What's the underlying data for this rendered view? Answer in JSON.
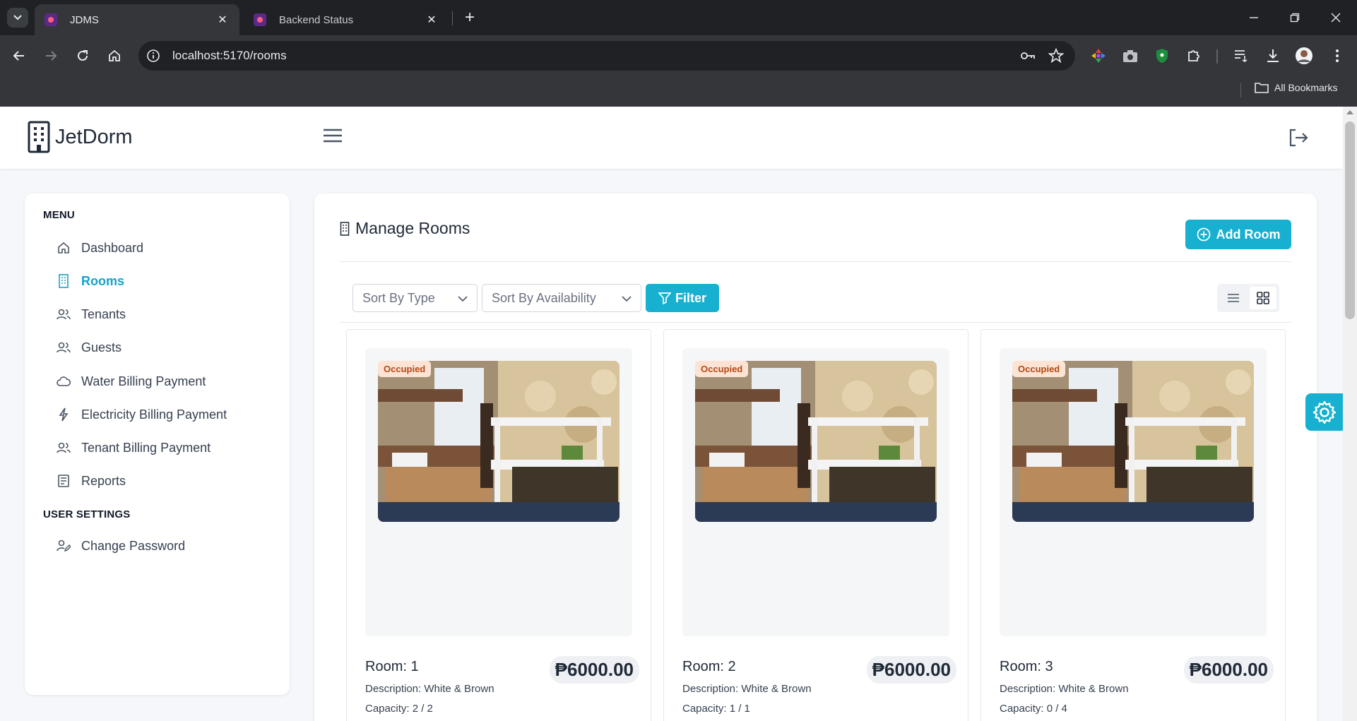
{
  "browser": {
    "tabs": [
      {
        "title": "JDMS",
        "active": true
      },
      {
        "title": "Backend Status",
        "active": false
      }
    ],
    "url": "localhost:5170/rooms",
    "bookmarks_label": "All Bookmarks"
  },
  "app": {
    "brand": "JetDorm",
    "accent_color": "#17b0d0"
  },
  "sidebar": {
    "menu_heading": "MENU",
    "items": [
      {
        "label": "Dashboard",
        "icon": "home-icon",
        "active": false
      },
      {
        "label": "Rooms",
        "icon": "building-icon",
        "active": true
      },
      {
        "label": "Tenants",
        "icon": "users-icon",
        "active": false
      },
      {
        "label": "Guests",
        "icon": "users-icon",
        "active": false
      },
      {
        "label": "Water Billing Payment",
        "icon": "cloud-icon",
        "active": false
      },
      {
        "label": "Electricity Billing Payment",
        "icon": "bolt-icon",
        "active": false
      },
      {
        "label": "Tenant Billing Payment",
        "icon": "users-icon",
        "active": false
      },
      {
        "label": "Reports",
        "icon": "document-icon",
        "active": false
      }
    ],
    "settings_heading": "USER SETTINGS",
    "settings_items": [
      {
        "label": "Change Password",
        "icon": "user-edit-icon"
      }
    ]
  },
  "main": {
    "title": "Manage Rooms",
    "add_button": "Add Room",
    "sort_type": "Sort By Type",
    "sort_availability": "Sort By Availability",
    "filter_button": "Filter",
    "rooms": [
      {
        "name": "Room: 1",
        "price": "₱6000.00",
        "description": "Description: White & Brown",
        "capacity": "Capacity: 2 / 2",
        "status": "Occupied"
      },
      {
        "name": "Room: 2",
        "price": "₱6000.00",
        "description": "Description: White & Brown",
        "capacity": "Capacity: 1 / 1",
        "status": "Occupied"
      },
      {
        "name": "Room: 3",
        "price": "₱6000.00",
        "description": "Description: White & Brown",
        "capacity": "Capacity: 0 / 4",
        "status": "Occupied"
      }
    ]
  }
}
